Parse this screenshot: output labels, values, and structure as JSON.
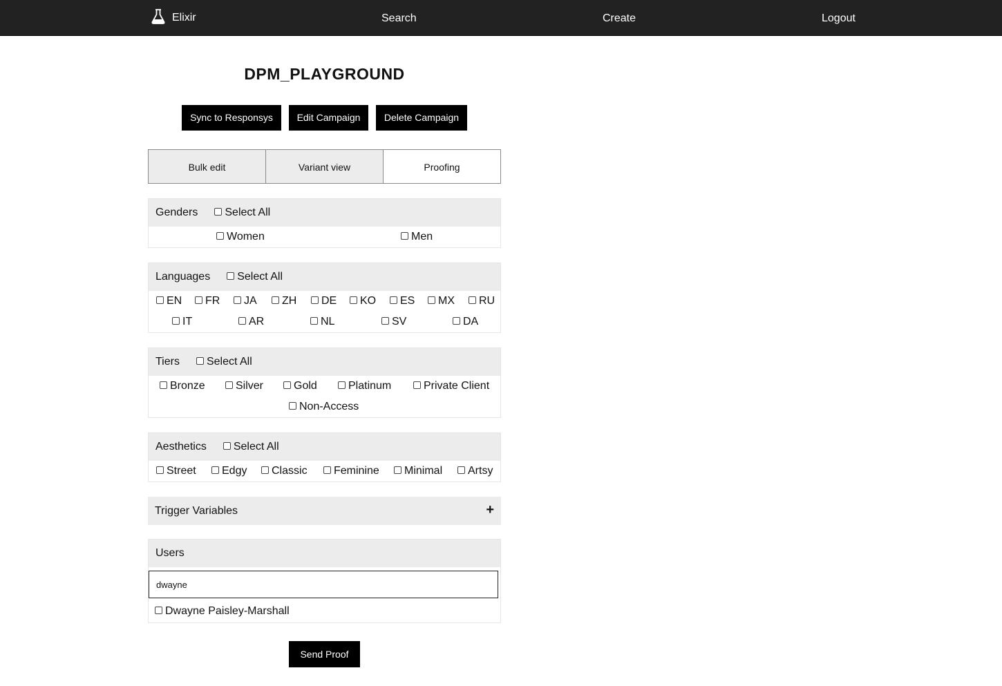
{
  "nav": {
    "brand": "Elixir",
    "search": "Search",
    "create": "Create",
    "logout": "Logout"
  },
  "campaign": {
    "title": "DPM_PLAYGROUND"
  },
  "actions": {
    "sync": "Sync to Responsys",
    "edit": "Edit Campaign",
    "delete": "Delete Campaign"
  },
  "tabs": [
    {
      "label": "Bulk edit",
      "active": false
    },
    {
      "label": "Variant view",
      "active": false
    },
    {
      "label": "Proofing",
      "active": true
    }
  ],
  "genders": {
    "label": "Genders",
    "select_all": "Select All",
    "options": [
      "Women",
      "Men"
    ]
  },
  "languages": {
    "label": "Languages",
    "select_all": "Select All",
    "options": [
      "EN",
      "FR",
      "JA",
      "ZH",
      "DE",
      "KO",
      "ES",
      "MX",
      "RU",
      "IT",
      "AR",
      "NL",
      "SV",
      "DA"
    ]
  },
  "tiers": {
    "label": "Tiers",
    "select_all": "Select All",
    "options": [
      "Bronze",
      "Silver",
      "Gold",
      "Platinum",
      "Private Client",
      "Non-Access"
    ]
  },
  "aesthetics": {
    "label": "Aesthetics",
    "select_all": "Select All",
    "options": [
      "Street",
      "Edgy",
      "Classic",
      "Feminine",
      "Minimal",
      "Artsy"
    ]
  },
  "trigger": {
    "label": "Trigger Variables",
    "expand": "+"
  },
  "users": {
    "label": "Users",
    "search_value": "dwayne",
    "results": [
      "Dwayne Paisley-Marshall"
    ]
  },
  "send_proof": "Send Proof"
}
